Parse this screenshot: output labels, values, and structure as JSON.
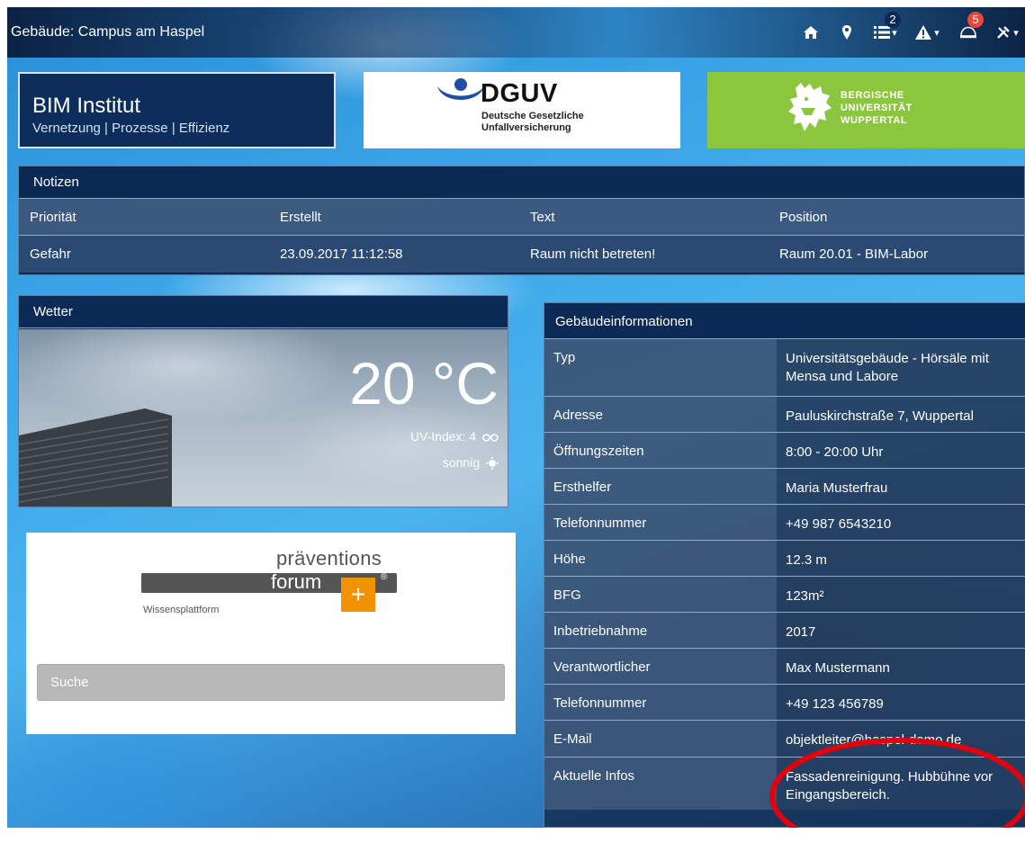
{
  "topbar": {
    "title": "Gebäude: Campus am Haspel",
    "icons": [
      "home-icon",
      "map-marker-icon",
      "list-icon",
      "warning-icon",
      "helmet-icon",
      "tools-icon"
    ],
    "list_badge": "2",
    "helmet_badge": "5"
  },
  "header": {
    "bim_title": "BIM Institut",
    "bim_subtitle": "Vernetzung | Prozesse | Effizienz",
    "dguv_name": "DGUV",
    "dguv_line1": "Deutsche Gesetzliche",
    "dguv_line2": "Unfallversicherung",
    "buw_line1": "BERGISCHE",
    "buw_line2": "UNIVERSITÄT",
    "buw_line3": "WUPPERTAL"
  },
  "notes": {
    "title": "Notizen",
    "columns": [
      "Priorität",
      "Erstellt",
      "Text",
      "Position"
    ],
    "rows": [
      [
        "Gefahr",
        "23.09.2017 11:12:58",
        "Raum nicht betreten!",
        "Raum 20.01 - BIM-Labor"
      ]
    ]
  },
  "weather": {
    "title": "Wetter",
    "temperature": "20 °C",
    "uv_index": "UV-Index: 4",
    "condition": "sonnig"
  },
  "praeventionsforum": {
    "line1": "präventions",
    "line2": "forum",
    "plus": "+",
    "registered": "®",
    "tagline": "Wissensplattform",
    "search_label": "Suche"
  },
  "building_info": {
    "title": "Gebäudeinformationen",
    "rows": [
      {
        "key": "Typ",
        "value": "Universitätsgebäude - Hörsäle mit Mensa und Labore"
      },
      {
        "key": "Adresse",
        "value": "Pauluskirchstraße 7, Wuppertal"
      },
      {
        "key": "Öffnungszeiten",
        "value": "8:00 - 20:00 Uhr"
      },
      {
        "key": "Ersthelfer",
        "value": "Maria Musterfrau"
      },
      {
        "key": "Telefonnummer",
        "value": "+49 987 6543210"
      },
      {
        "key": "Höhe",
        "value": "12.3 m"
      },
      {
        "key": "BFG",
        "value": "123m²"
      },
      {
        "key": "Inbetriebnahme",
        "value": "2017"
      },
      {
        "key": "Verantwortlicher",
        "value": "Max Mustermann"
      },
      {
        "key": "Telefonnummer",
        "value": "+49 123 456789"
      },
      {
        "key": "E-Mail",
        "value": "objektleiter@haspel-demo.de"
      },
      {
        "key": "Aktuelle Infos",
        "value": "Fassadenreinigung. Hubbühne vor Eingangsbereich."
      }
    ]
  },
  "colors": {
    "panel_navy": "#0b2a55",
    "dguv_blue": "#1f4fa3",
    "buw_green": "#8cc63f",
    "pf_orange": "#f39200",
    "annotation_red": "#e3000f",
    "badge_red": "#e8473b"
  }
}
